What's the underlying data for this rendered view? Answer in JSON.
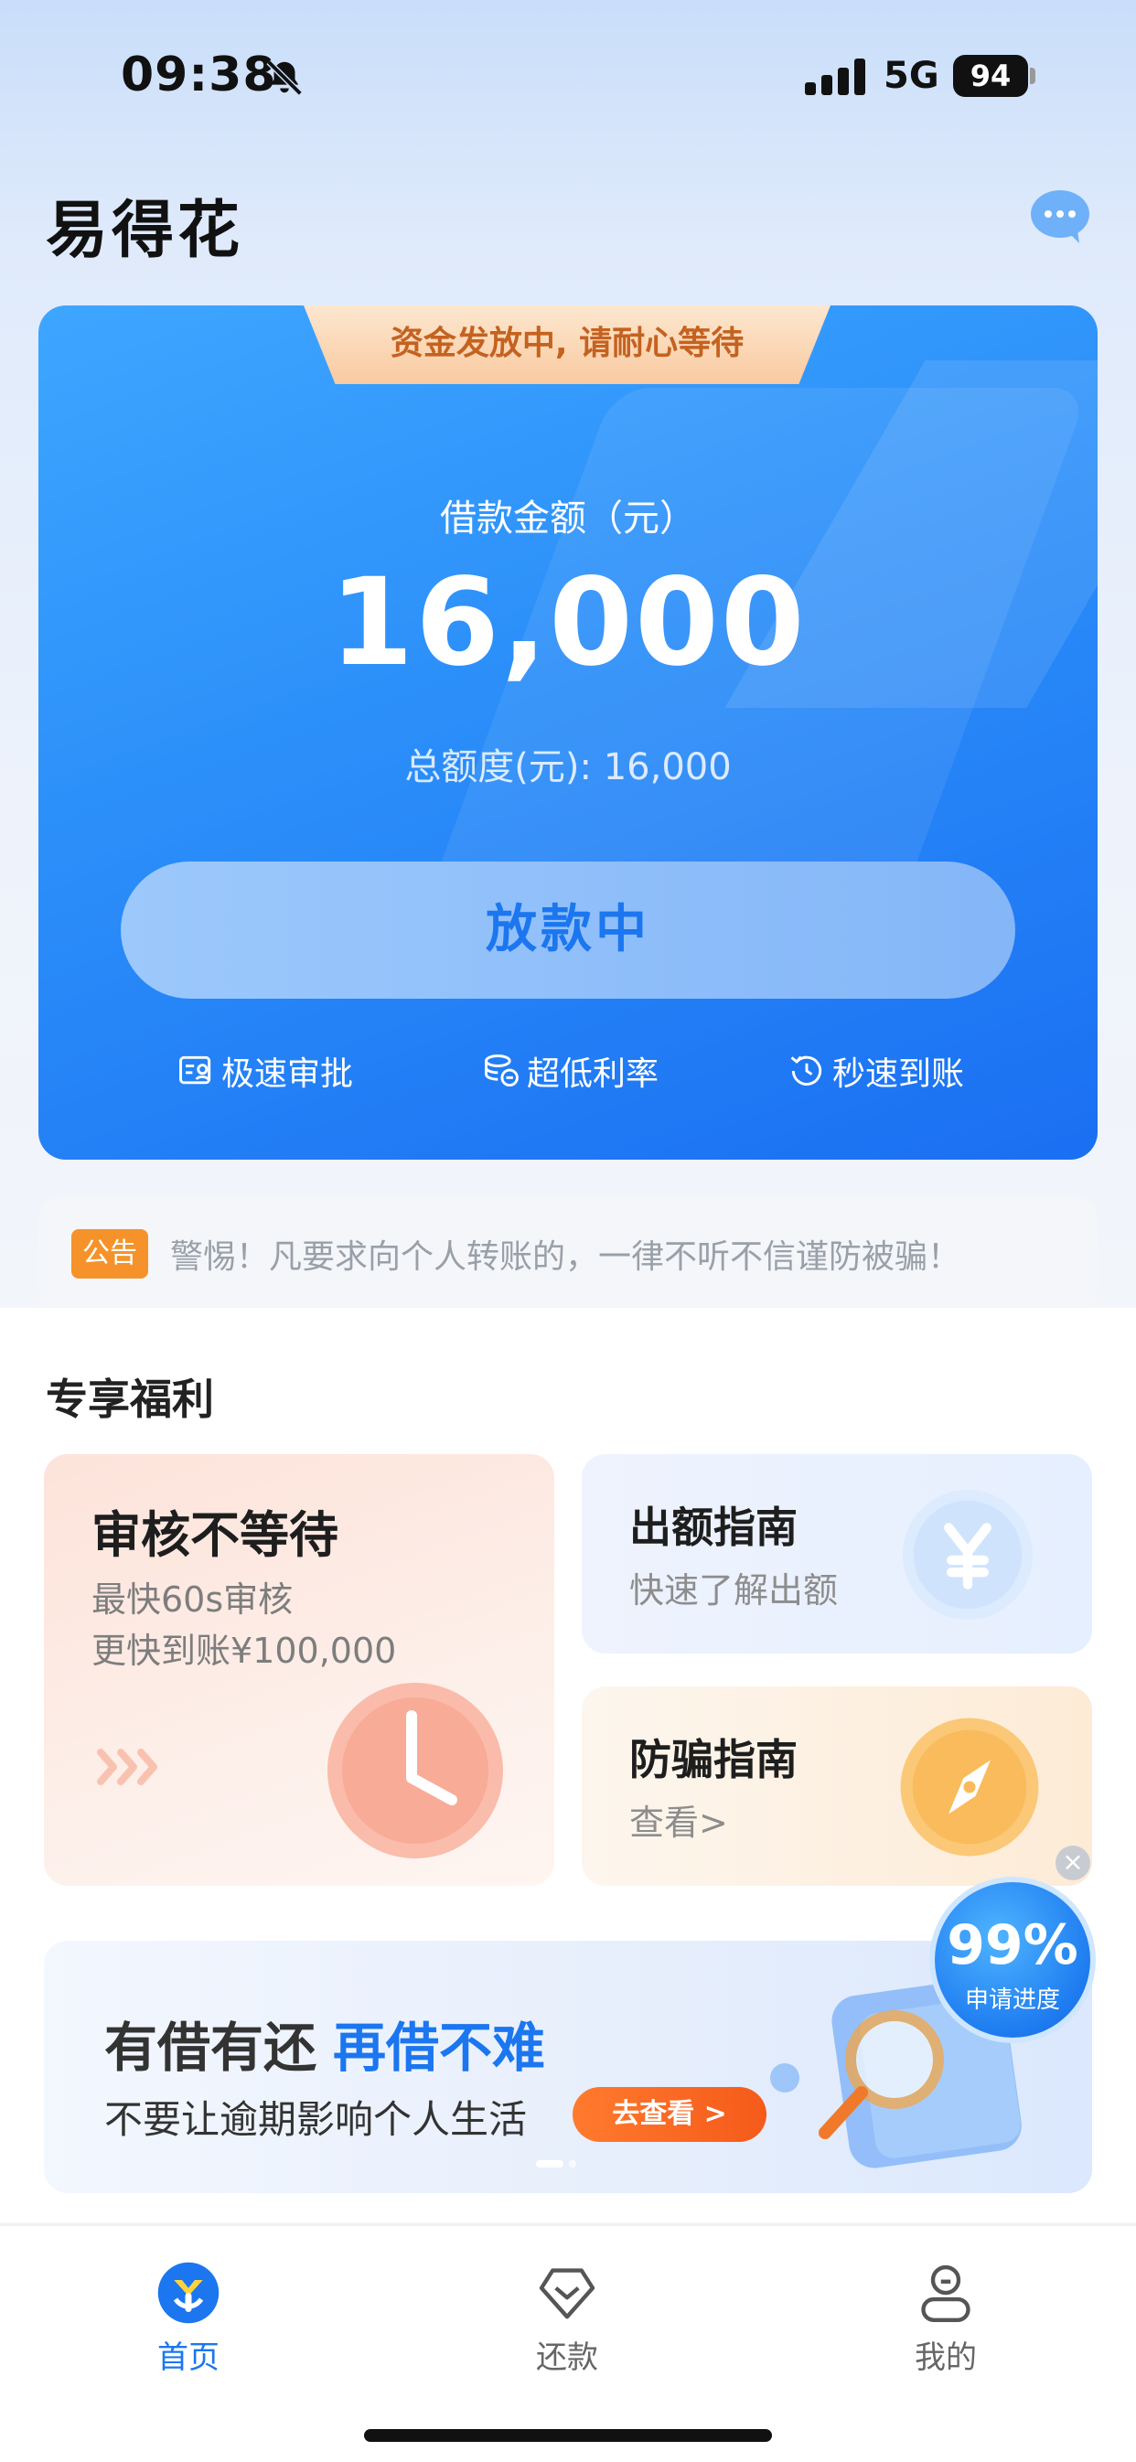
{
  "status_bar": {
    "time": "09:38",
    "network": "5G",
    "battery": "94"
  },
  "header": {
    "app_title": "易得花"
  },
  "loan_card": {
    "banner": "资金发放中, 请耐心等待",
    "amount_label": "借款金额（元）",
    "amount": "16,000",
    "total_credit": "总额度(元): 16,000",
    "status_button": "放款中",
    "features": [
      "极速审批",
      "超低利率",
      "秒速到账"
    ]
  },
  "notice": {
    "badge": "公告",
    "text": "警惕！凡要求向个人转账的，一律不听不信谨防被骗！"
  },
  "benefits": {
    "title": "专享福利",
    "review": {
      "title": "审核不等待",
      "line1": "最快60s审核",
      "line2": "更快到账¥100,000"
    },
    "guide": {
      "title": "出额指南",
      "subtitle": "快速了解出额"
    },
    "fraud": {
      "title": "防骗指南",
      "subtitle": "查看>"
    }
  },
  "promo": {
    "title": "有借有还",
    "highlight": "再借不难",
    "subtitle": "不要让逾期影响个人生活",
    "button": "去查看 >"
  },
  "progress": {
    "value": "99%",
    "label": "申请进度"
  },
  "tabbar": {
    "home": "首页",
    "repay": "还款",
    "mine": "我的"
  },
  "colors": {
    "primary": "#1b76ef",
    "accent_orange": "#f5932a",
    "banner_text": "#c46220"
  }
}
